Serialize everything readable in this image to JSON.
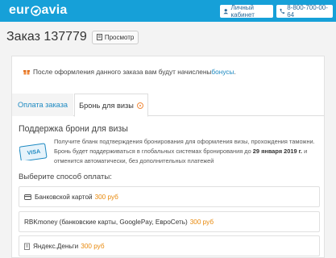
{
  "header": {
    "logo_left": "eur",
    "logo_right": "avia",
    "cabinet_label": "Личный кабинет",
    "phone_label": "8-800-700-00-64"
  },
  "order": {
    "title": "Заказ 137779",
    "view_label": "Просмотр"
  },
  "bonus": {
    "text": "После оформления данного заказа вам будут начислены ",
    "link": "бонусы",
    "end": "."
  },
  "tabs": [
    {
      "label": "Оплата заказа",
      "active": false
    },
    {
      "label": "Бронь для визы",
      "active": true
    }
  ],
  "visa": {
    "title": "Поддержка брони для визы",
    "text_part1": "Получите бланк подтверждения бронирования для оформления визы, прохождения таможни. Бронь будет поддерживаться в глобальных системах бронирования до ",
    "text_date": "29 января 2019 г.",
    "text_part2": " и отменится автоматически, без дополнительных платежей",
    "icon_label": "VISA"
  },
  "payment": {
    "choose_label": "Выберите способ оплаты:",
    "options": [
      {
        "label": "Банковской картой",
        "price": "300 руб",
        "icon": "card-icon"
      },
      {
        "label": "RBKmoney (банковские карты, GooglePay, ЕвроСеть)",
        "price": "300 руб",
        "icon": "none"
      },
      {
        "label": "Яндекс.Деньги",
        "price": "300 руб",
        "icon": "yandex-money-icon"
      }
    ]
  },
  "colors": {
    "brand": "#16a0d8",
    "link": "#1e8ac2",
    "price": "#e8890c"
  }
}
